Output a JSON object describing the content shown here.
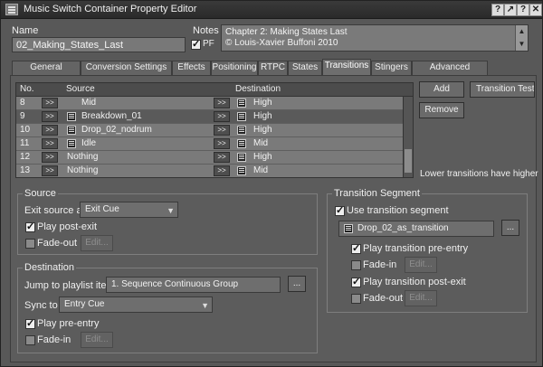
{
  "window": {
    "title": "Music Switch Container Property Editor"
  },
  "header": {
    "name_label": "Name",
    "name_value": "02_Making_States_Last",
    "notes_label": "Notes",
    "pf_label": "PF",
    "notes_line1": "Chapter 2: Making States Last",
    "notes_line2": "© Louis-Xavier Buffoni 2010"
  },
  "tabs": [
    {
      "label": "General Settings"
    },
    {
      "label": "Conversion Settings"
    },
    {
      "label": "Effects"
    },
    {
      "label": "Positioning"
    },
    {
      "label": "RTPC"
    },
    {
      "label": "States"
    },
    {
      "label": "Transitions"
    },
    {
      "label": "Stingers"
    },
    {
      "label": "Advanced Settings"
    }
  ],
  "grid": {
    "col_no": "No.",
    "col_source": "Source",
    "col_destination": "Destination",
    "arrow": ">>",
    "rows": [
      {
        "no": "8",
        "source": "Mid",
        "dest": "High"
      },
      {
        "no": "9",
        "source": "Breakdown_01",
        "dest": "High"
      },
      {
        "no": "10",
        "source": "Drop_02_nodrum",
        "dest": "High"
      },
      {
        "no": "11",
        "source": "Idle",
        "dest": "Mid"
      },
      {
        "no": "12",
        "source": "Nothing",
        "dest": "High"
      },
      {
        "no": "13",
        "source": "Nothing",
        "dest": "Mid"
      }
    ]
  },
  "side": {
    "add": "Add",
    "transition_test": "Transition Testi",
    "remove": "Remove",
    "note": "Lower transitions have higher"
  },
  "source": {
    "title": "Source",
    "exit_label": "Exit source at",
    "exit_value": "Exit Cue",
    "play_post_exit": "Play post-exit",
    "fade_out": "Fade-out",
    "edit": "Edit..."
  },
  "destination": {
    "title": "Destination",
    "jump_label": "Jump to playlist item",
    "jump_value": "1. Sequence Continuous Group",
    "browse": "...",
    "sync_label": "Sync to",
    "sync_value": "Entry Cue",
    "play_pre_entry": "Play pre-entry",
    "fade_in": "Fade-in",
    "edit": "Edit..."
  },
  "segment": {
    "title": "Transition Segment",
    "use_label": "Use transition segment",
    "segment_value": "Drop_02_as_transition",
    "browse": "...",
    "play_pre_entry": "Play transition pre-entry",
    "fade_in": "Fade-in",
    "play_post_exit": "Play transition post-exit",
    "fade_out": "Fade-out",
    "edit": "Edit..."
  }
}
